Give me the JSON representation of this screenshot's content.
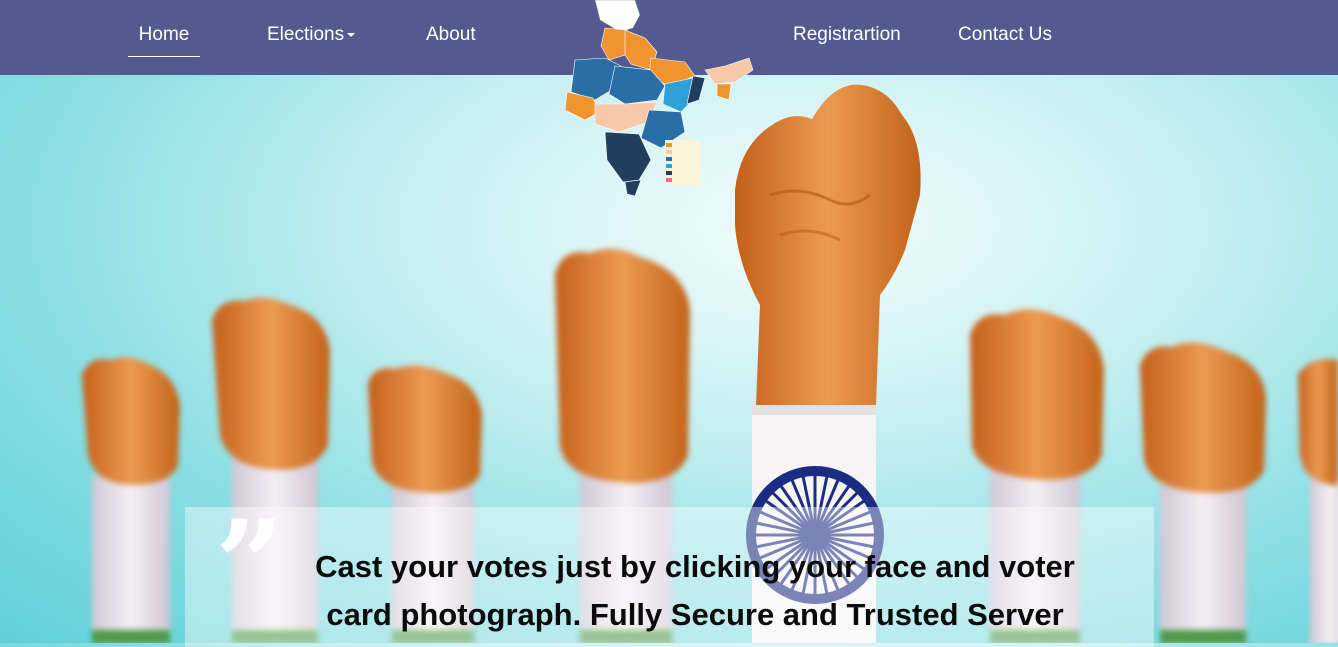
{
  "nav": {
    "home": "Home",
    "elections": "Elections",
    "about": "About",
    "registration": "Registrartion",
    "contact": "Contact Us"
  },
  "hero": {
    "quote_line1": "Cast your votes just by clicking your face and voter",
    "quote_line2": "card photograph. Fully Secure and Trusted Server"
  },
  "icons": {
    "map": "india-map-icon",
    "quote": "quote-mark-icon",
    "wheel": "ashoka-chakra-icon"
  },
  "colors": {
    "navbar": "#525a8f",
    "saffron": "#e07a1f",
    "chakra": "#1c2c82"
  }
}
